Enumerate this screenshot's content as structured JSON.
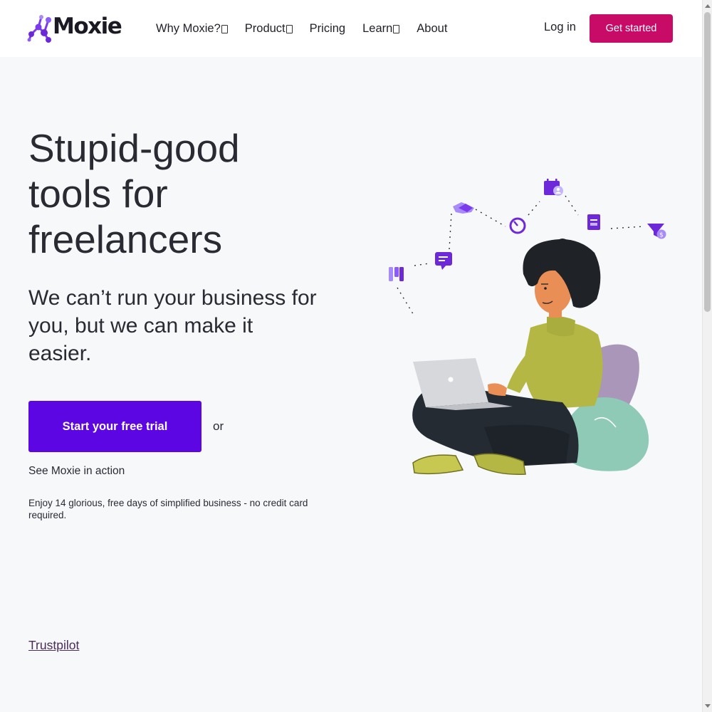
{
  "brand": {
    "logo_text": "Moxie",
    "primary_color": "#5b06e3",
    "accent_color": "#c70b67"
  },
  "header": {
    "nav": [
      {
        "label": "Why Moxie?",
        "has_dropdown": true
      },
      {
        "label": "Product",
        "has_dropdown": true
      },
      {
        "label": "Pricing",
        "has_dropdown": false
      },
      {
        "label": "Learn",
        "has_dropdown": true
      },
      {
        "label": "About",
        "has_dropdown": false
      }
    ],
    "login_label": "Log in",
    "get_started_label": "Get started"
  },
  "hero": {
    "title": "Stupid-good tools for freelancers",
    "subtitle": "We can’t run your business for you, but we can make it easier.",
    "cta_label": "Start your free trial",
    "or_text": "or",
    "see_action_label": "See Moxie in action",
    "trial_note": "Enjoy 14 glorious, free days of simplified business - no credit card required."
  },
  "footer_link": {
    "trustpilot_label": "Trustpilot"
  },
  "icons": [
    "moxie-logo-icon",
    "kanban-icon",
    "chat-icon",
    "handshake-icon",
    "timer-icon",
    "calendar-user-icon",
    "invoice-icon",
    "funnel-dollar-icon"
  ]
}
